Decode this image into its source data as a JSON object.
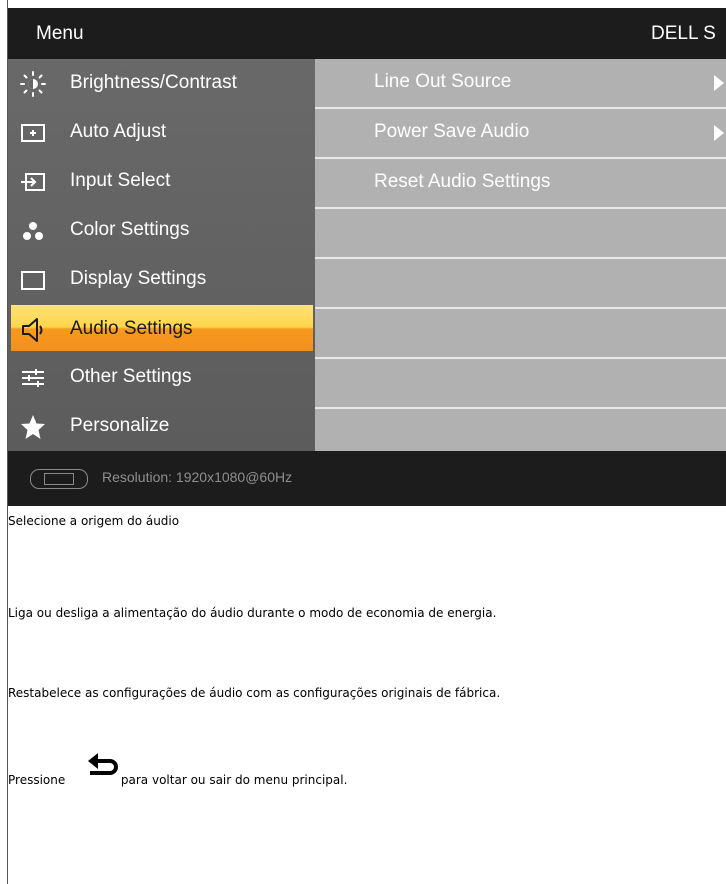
{
  "osd": {
    "title": "Menu",
    "brand": "DELL S",
    "menu_items": [
      {
        "label": "Brightness/Contrast",
        "icon": "brightness-icon"
      },
      {
        "label": "Auto Adjust",
        "icon": "auto-adjust-icon"
      },
      {
        "label": "Input Select",
        "icon": "input-select-icon"
      },
      {
        "label": "Color Settings",
        "icon": "color-settings-icon"
      },
      {
        "label": "Display Settings",
        "icon": "display-settings-icon"
      },
      {
        "label": "Audio Settings",
        "icon": "speaker-icon",
        "selected": true
      },
      {
        "label": "Other Settings",
        "icon": "sliders-icon"
      },
      {
        "label": "Personalize",
        "icon": "star-icon"
      }
    ],
    "submenu": [
      {
        "label": "Line Out Source",
        "has_arrow": true
      },
      {
        "label": "Power Save Audio",
        "has_arrow": true
      },
      {
        "label": "Reset Audio Settings",
        "has_arrow": false
      },
      {
        "label": ""
      },
      {
        "label": ""
      },
      {
        "label": ""
      },
      {
        "label": ""
      },
      {
        "label": ""
      }
    ],
    "footer": {
      "resolution": "Resolution:  1920x1080@60Hz",
      "icon": "vga-connector-icon"
    }
  },
  "descriptions": {
    "line_out": "Selecione a origem do áudio",
    "power_save": "Liga ou desliga a alimentação do áudio durante o modo de economia de energia.",
    "reset": "Restabelece as configurações de áudio com as configurações originais de fábrica.",
    "press_before": "Pressione",
    "press_after": "para voltar ou sair do menu principal."
  },
  "colors": {
    "header_bg": "#1c1c1c",
    "left_panel": "#666666",
    "right_panel": "#b1b1b1",
    "selected_top": "#ffd54a",
    "selected_bottom": "#f3901a"
  }
}
